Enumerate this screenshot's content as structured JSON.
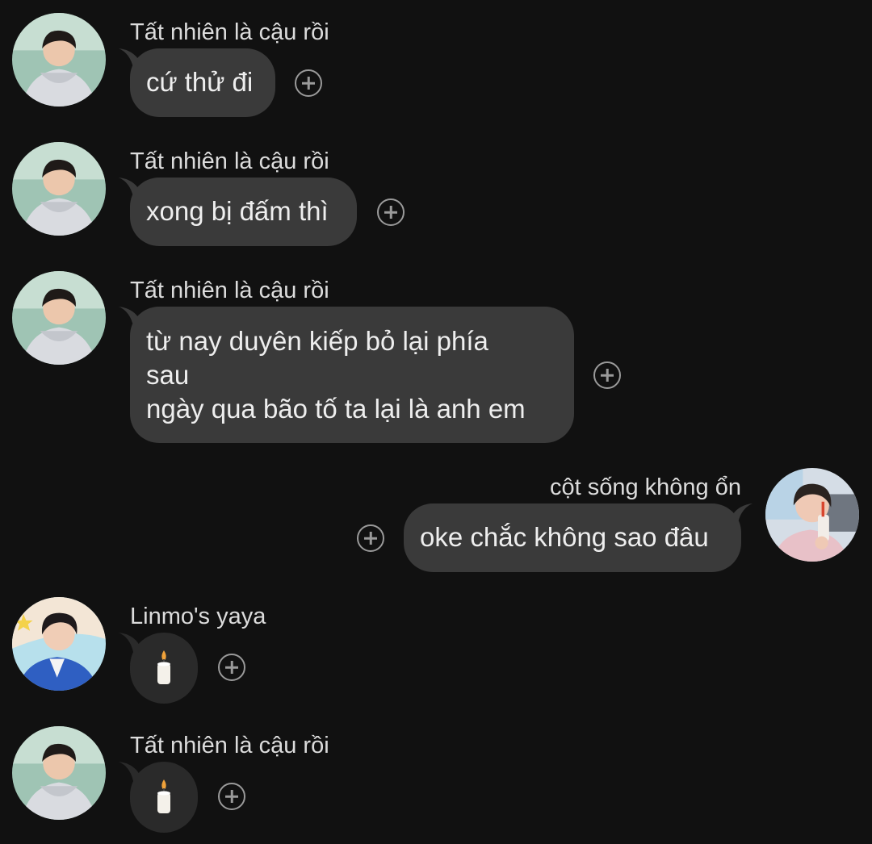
{
  "messages": [
    {
      "sender": "Tất nhiên là cậu rồi",
      "text": "cứ thử đi",
      "side": "left",
      "avatar": "avatar-boy-grey-hoodie"
    },
    {
      "sender": "Tất nhiên là cậu rồi",
      "text": "xong bị đấm thì",
      "side": "left",
      "avatar": "avatar-boy-grey-hoodie"
    },
    {
      "sender": "Tất nhiên là cậu rồi",
      "text": "từ nay duyên kiếp bỏ lại phía\nsau\nngày qua bão tố ta lại là anh em",
      "side": "left",
      "avatar": "avatar-boy-grey-hoodie"
    },
    {
      "sender": "cột sống không ổn",
      "text": "oke chắc không sao đâu",
      "side": "right",
      "avatar": "avatar-boy-drinking"
    },
    {
      "sender": "Linmo's yaya",
      "text": "",
      "emoji": "candle-icon",
      "side": "left",
      "avatar": "avatar-boy-blue-suit"
    },
    {
      "sender": "Tất nhiên là cậu rồi",
      "text": "",
      "emoji": "candle-icon",
      "side": "left",
      "avatar": "avatar-boy-grey-hoodie"
    }
  ],
  "colors": {
    "background": "#111111",
    "bubble": "#3a3a3a",
    "text": "#eeeeee",
    "react_icon": "#9a9a9a"
  },
  "icons": {
    "react": "add-reaction-icon",
    "candle": "candle-icon"
  }
}
